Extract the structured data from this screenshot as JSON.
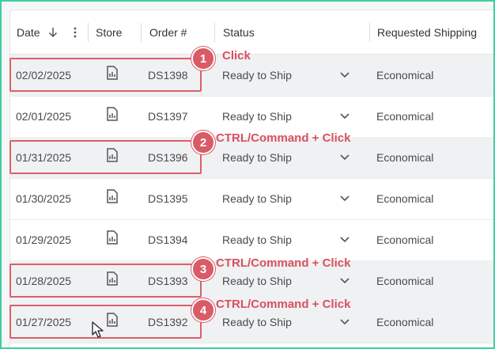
{
  "table": {
    "columns": {
      "date": "Date",
      "store": "Store",
      "order": "Order #",
      "status": "Status",
      "shipping": "Requested Shipping"
    },
    "rows": [
      {
        "date": "02/02/2025",
        "order": "DS1398",
        "status": "Ready to Ship",
        "shipping": "Economical",
        "selected": true
      },
      {
        "date": "02/01/2025",
        "order": "DS1397",
        "status": "Ready to Ship",
        "shipping": "Economical",
        "selected": false
      },
      {
        "date": "01/31/2025",
        "order": "DS1396",
        "status": "Ready to Ship",
        "shipping": "Economical",
        "selected": true
      },
      {
        "date": "01/30/2025",
        "order": "DS1395",
        "status": "Ready to Ship",
        "shipping": "Economical",
        "selected": false
      },
      {
        "date": "01/29/2025",
        "order": "DS1394",
        "status": "Ready to Ship",
        "shipping": "Economical",
        "selected": false
      },
      {
        "date": "01/28/2025",
        "order": "DS1393",
        "status": "Ready to Ship",
        "shipping": "Economical",
        "selected": true
      },
      {
        "date": "01/27/2025",
        "order": "DS1392",
        "status": "Ready to Ship",
        "shipping": "Economical",
        "selected": true
      }
    ]
  },
  "annotations": [
    {
      "number": "1",
      "text": "Click"
    },
    {
      "number": "2",
      "text": "CTRL/Command + Click"
    },
    {
      "number": "3",
      "text": "CTRL/Command + Click"
    },
    {
      "number": "4",
      "text": "CTRL/Command + Click"
    }
  ],
  "icons": {
    "sort": "arrow-down-icon",
    "menu": "kebab-menu-icon",
    "store": "document-chart-icon",
    "status_toggle": "chevron-down-icon",
    "cursor": "mouse-pointer-icon"
  },
  "colors": {
    "frame": "#3fcf9f",
    "highlight": "#d9606a",
    "annotation_text": "#d95060",
    "selected_row": "#f0f1f3"
  }
}
